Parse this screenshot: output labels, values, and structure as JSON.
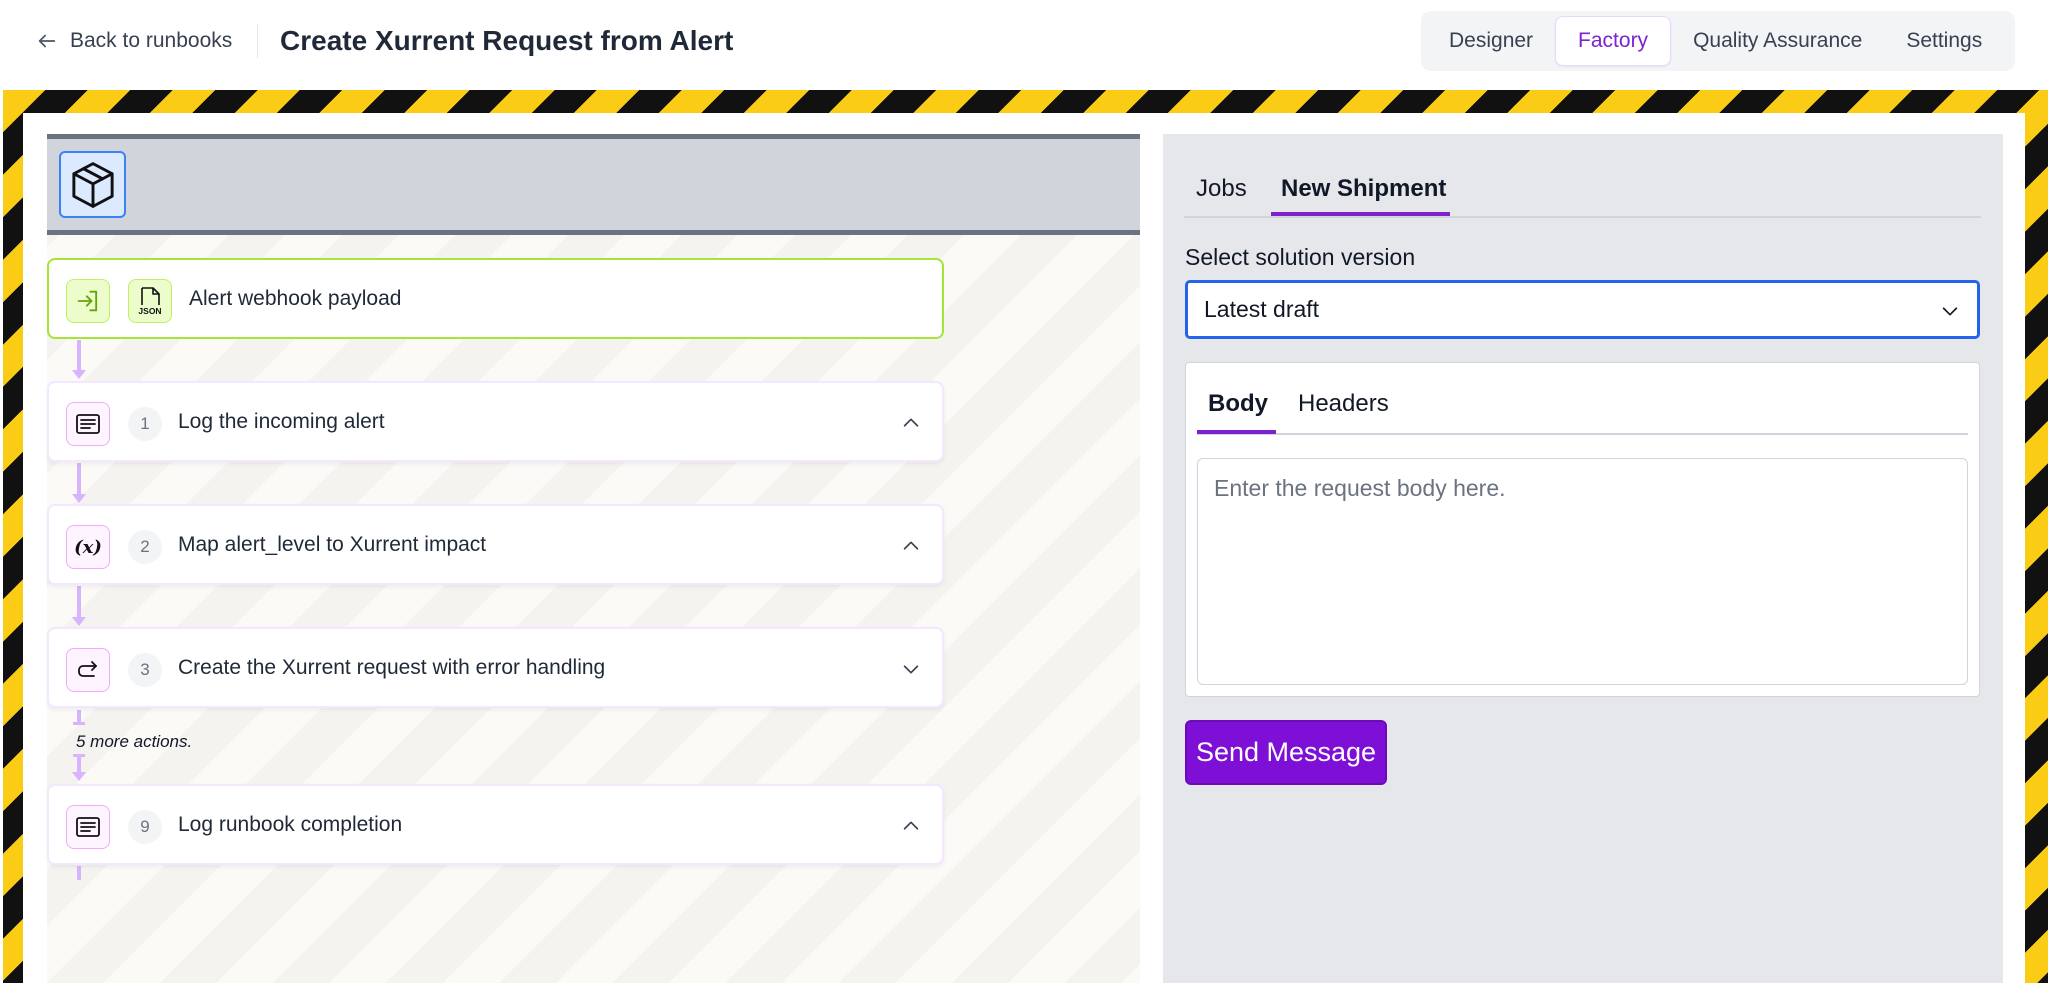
{
  "header": {
    "back_label": "Back to runbooks",
    "title": "Create Xurrent Request from Alert",
    "mode_tabs": [
      {
        "label": "Designer",
        "active": false
      },
      {
        "label": "Factory",
        "active": true
      },
      {
        "label": "Quality Assurance",
        "active": false
      },
      {
        "label": "Settings",
        "active": false
      }
    ]
  },
  "canvas": {
    "header_icon": "cube-icon",
    "trigger": {
      "label": "Alert webhook payload",
      "icons": [
        "enter-icon",
        "json-file-icon"
      ],
      "json_text": "JSON"
    },
    "steps": [
      {
        "number": "1",
        "label": "Log the incoming alert",
        "icon": "log-lines-icon",
        "expanded": true
      },
      {
        "number": "2",
        "label": "Map alert_level to Xurrent impact",
        "icon": "variable-icon",
        "icon_text": "(x)",
        "expanded": true
      },
      {
        "number": "3",
        "label": "Create the Xurrent request with error handling",
        "icon": "redirect-arrow-icon",
        "expanded": false
      },
      {
        "number": "9",
        "label": "Log runbook completion",
        "icon": "log-lines-icon",
        "expanded": true
      }
    ],
    "more_actions": "5 more actions."
  },
  "panel": {
    "tabs": [
      {
        "label": "Jobs",
        "active": false
      },
      {
        "label": "New Shipment",
        "active": true
      }
    ],
    "version_label": "Select solution version",
    "version_value": "Latest draft",
    "body_tabs": [
      {
        "label": "Body",
        "active": true
      },
      {
        "label": "Headers",
        "active": false
      }
    ],
    "body_placeholder": "Enter the request body here.",
    "send_label": "Send Message"
  },
  "colors": {
    "accent": "#7e22ce",
    "send_button": "#7e0fd6",
    "hazard_yellow": "#facc15",
    "hazard_black": "#111111",
    "trigger_border": "#a3e635",
    "connector": "#d8b4fe"
  }
}
